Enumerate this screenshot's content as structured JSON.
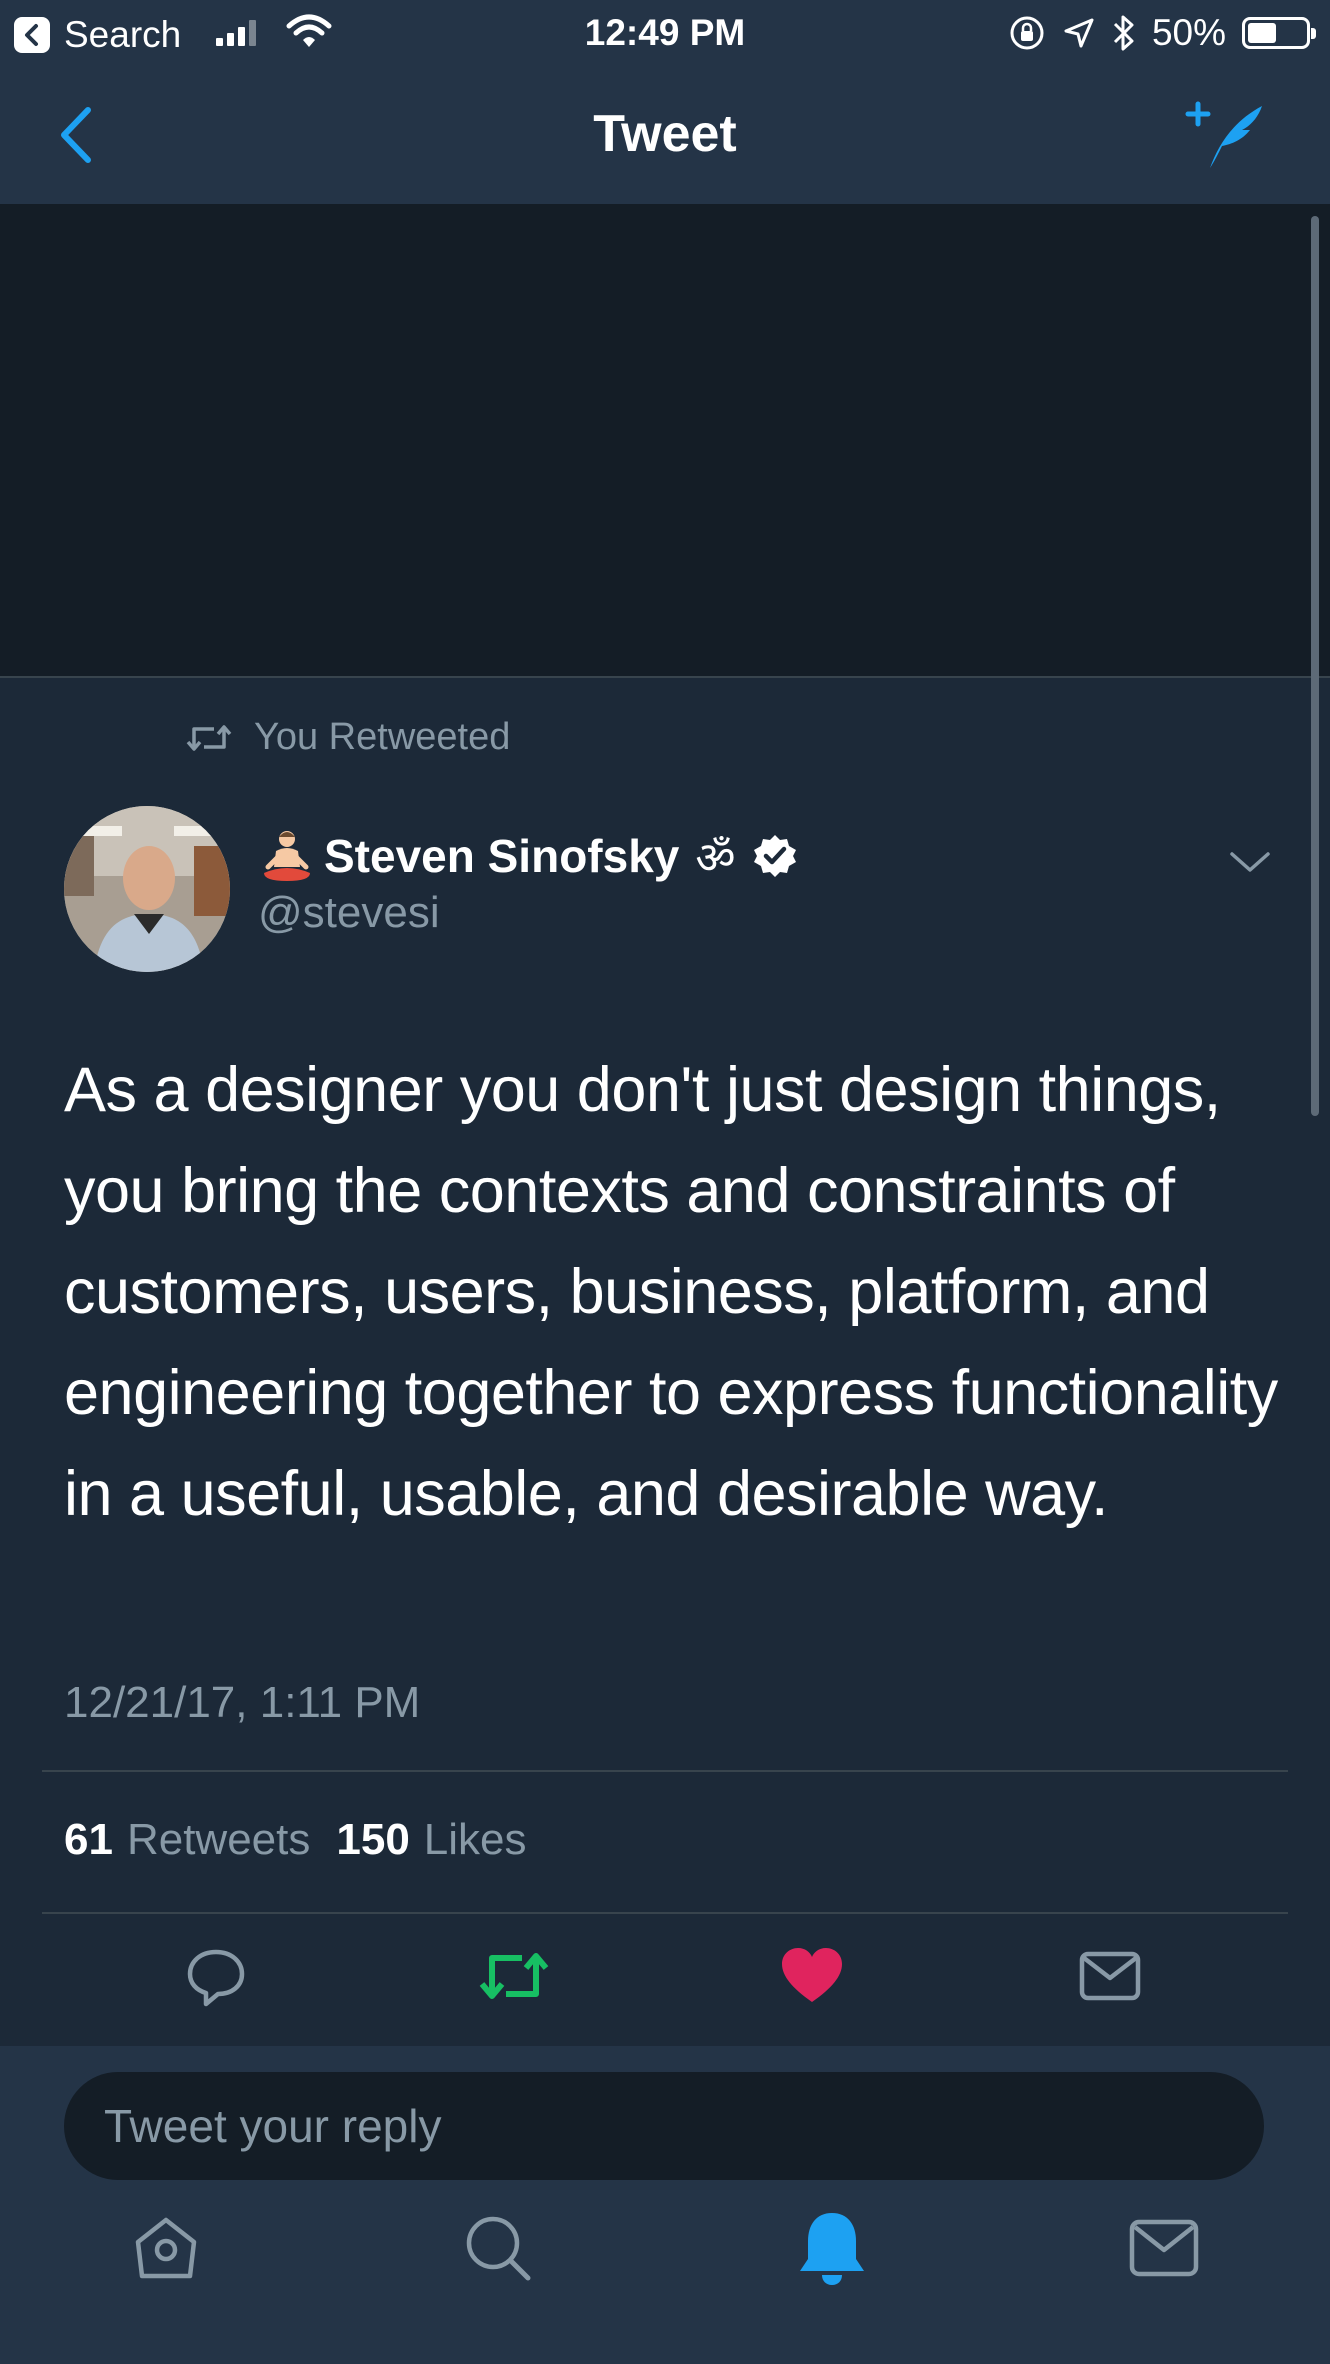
{
  "status_bar": {
    "back_app_label": "Search",
    "time": "12:49 PM",
    "battery_percent": "50%",
    "battery_level": 0.5,
    "icons": [
      "signal-icon",
      "wifi-icon",
      "orientation-lock-icon",
      "location-icon",
      "bluetooth-icon",
      "battery-icon"
    ]
  },
  "nav": {
    "title": "Tweet",
    "back_icon": "chevron-left-icon",
    "compose_icon": "compose-tweet-icon"
  },
  "tweet": {
    "retweet_context": "You Retweeted",
    "author": {
      "name": "Steven Sinofsky",
      "name_suffix": "ॐ",
      "handle": "@stevesi",
      "verified": true
    },
    "text": "As a designer you don't just design things, you bring the contexts and constraints of customers, users, business, platform, and engineering together to express functionality in a useful, usable, and desirable way.",
    "timestamp": "12/21/17, 1:11 PM",
    "stats": {
      "retweets_count": "61",
      "retweets_label": "Retweets",
      "likes_count": "150",
      "likes_label": "Likes"
    },
    "actions": [
      {
        "name": "reply",
        "icon": "reply-icon"
      },
      {
        "name": "retweet",
        "icon": "retweet-icon",
        "active": true,
        "color": "#17bf63"
      },
      {
        "name": "like",
        "icon": "heart-icon",
        "active": true,
        "color": "#e0245e"
      },
      {
        "name": "share",
        "icon": "envelope-icon"
      }
    ]
  },
  "reply": {
    "placeholder": "Tweet your reply"
  },
  "tab_bar": {
    "tabs": [
      {
        "name": "home",
        "icon": "home-icon"
      },
      {
        "name": "search",
        "icon": "search-icon"
      },
      {
        "name": "notifications",
        "icon": "bell-icon",
        "active": true
      },
      {
        "name": "messages",
        "icon": "envelope-icon"
      }
    ]
  },
  "colors": {
    "background": "#1c2938",
    "bar": "#243447",
    "accent": "#1da1f2",
    "muted": "#8899a6",
    "retweet_green": "#17bf63",
    "like_red": "#e0245e"
  }
}
